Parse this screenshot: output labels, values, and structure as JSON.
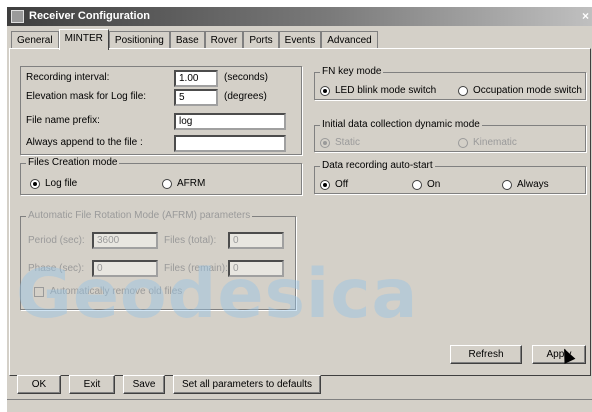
{
  "window": {
    "title": "Receiver Configuration",
    "close_glyph": "×"
  },
  "tabs": [
    "General",
    "MINTER",
    "Positioning",
    "Base",
    "Rover",
    "Ports",
    "Events",
    "Advanced"
  ],
  "active_tab": "MINTER",
  "recording": {
    "interval_label": "Recording interval:",
    "interval_value": "1.00",
    "interval_unit": "(seconds)",
    "elevation_label": "Elevation mask for Log file:",
    "elevation_value": "5",
    "elevation_unit": "(degrees)",
    "prefix_label": "File name prefix:",
    "prefix_value": "log",
    "append_label": "Always append to the file :",
    "append_value": ""
  },
  "files_creation": {
    "title": "Files Creation mode",
    "options": [
      "Log file",
      "AFRM"
    ],
    "selected": "Log file"
  },
  "fn_key": {
    "title": "FN key mode",
    "options": [
      "LED blink mode switch",
      "Occupation mode switch"
    ],
    "selected": "LED blink mode switch"
  },
  "dynamic_mode": {
    "title": "Initial data collection dynamic mode",
    "options": [
      "Static",
      "Kinematic"
    ],
    "selected": "Static",
    "disabled": true
  },
  "auto_start": {
    "title": "Data recording auto-start",
    "options": [
      "Off",
      "On",
      "Always"
    ],
    "selected": "Off"
  },
  "afrm": {
    "title": "Automatic File Rotation Mode (AFRM) parameters",
    "period_label": "Period (sec):",
    "period_value": "3600",
    "files_total_label": "Files (total):",
    "files_total_value": "0",
    "phase_label": "Phase (sec):",
    "phase_value": "0",
    "files_remain_label": "Files (remain):",
    "files_remain_value": "0",
    "auto_remove_label": "Automatically remove old files"
  },
  "panel_buttons": {
    "refresh": "Refresh",
    "apply": "Apply"
  },
  "footer_buttons": {
    "ok": "OK",
    "exit": "Exit",
    "save": "Save",
    "defaults": "Set all parameters to defaults"
  },
  "watermark": "Geodesica"
}
